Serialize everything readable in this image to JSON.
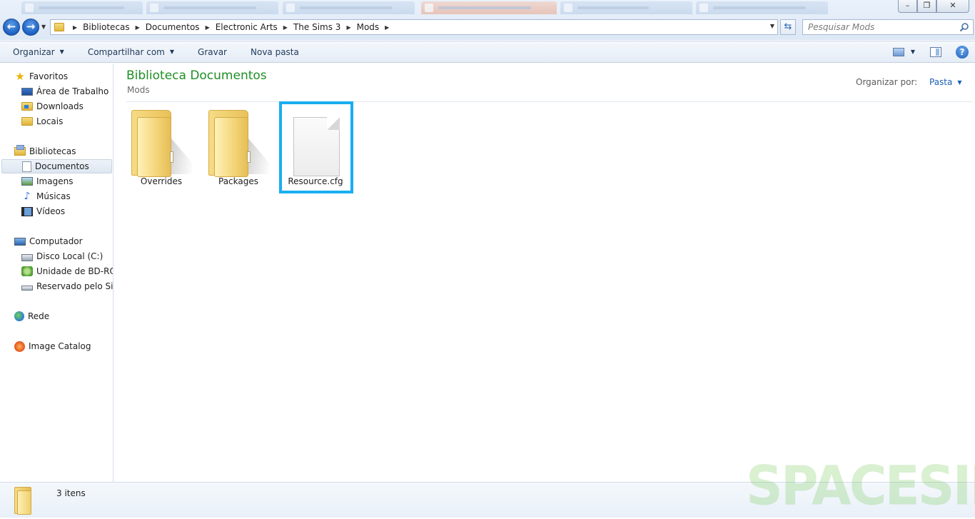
{
  "window": {
    "controls": [
      "–",
      "❐",
      "✕"
    ]
  },
  "navigation": {
    "breadcrumb": [
      "Bibliotecas",
      "Documentos",
      "Electronic Arts",
      "The Sims 3",
      "Mods"
    ],
    "search_placeholder": "Pesquisar Mods"
  },
  "toolbar": {
    "organize": "Organizar",
    "share": "Compartilhar com",
    "burn": "Gravar",
    "new_folder": "Nova pasta"
  },
  "sidebar": {
    "favorites": {
      "label": "Favoritos",
      "items": [
        "Área de Trabalho",
        "Downloads",
        "Locais"
      ]
    },
    "libraries": {
      "label": "Bibliotecas",
      "items": [
        "Documentos",
        "Imagens",
        "Músicas",
        "Vídeos"
      ],
      "selected": "Documentos"
    },
    "computer": {
      "label": "Computador",
      "items": [
        "Disco Local (C:)",
        "Unidade de BD-ROM",
        "Reservado pelo Sistema"
      ]
    },
    "network": "Rede",
    "image_catalog": "Image Catalog"
  },
  "content": {
    "title": "Biblioteca Documentos",
    "subtitle": "Mods",
    "arrange_label": "Organizar por:",
    "arrange_value": "Pasta",
    "files": [
      {
        "name": "Overrides",
        "type": "folder"
      },
      {
        "name": "Packages",
        "type": "folder"
      },
      {
        "name": "Resource.cfg",
        "type": "file",
        "selected": true
      }
    ]
  },
  "status": {
    "count": "3 itens"
  },
  "watermark": "SPACESIMS",
  "colors": {
    "title_green": "#1e8f24",
    "selection_cyan": "#19aef0",
    "link_blue": "#1b5fb3"
  }
}
